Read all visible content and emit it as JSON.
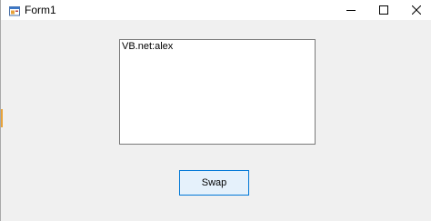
{
  "window": {
    "title": "Form1",
    "controls": {
      "minimize_icon": "minimize-icon",
      "maximize_icon": "maximize-icon",
      "close_icon": "close-icon"
    }
  },
  "main": {
    "textbox_text": "VB.net:alex",
    "swap_button_label": "Swap"
  },
  "colors": {
    "button_border": "#0078d7",
    "button_background": "#e5f1fb",
    "form_background": "#f0f0f0"
  }
}
